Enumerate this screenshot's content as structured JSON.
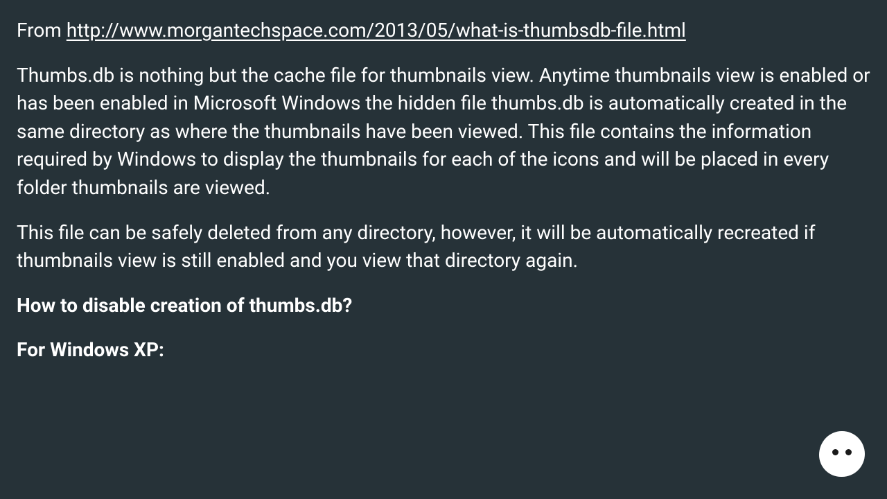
{
  "source": {
    "prefix": "From ",
    "url": "http://www.morgantechspace.com/2013/05/what-is-thumbsdb-file.html"
  },
  "paragraphs": {
    "p1": "Thumbs.db is nothing but the cache file for thumbnails view. Anytime thumbnails view is enabled or has been enabled in Microsoft Windows the hidden file thumbs.db is automatically created in the same directory as where the thumbnails have been viewed. This file contains the information required by Windows to display the thumbnails for each of the icons and will be placed in every folder thumbnails are viewed.",
    "p2": "This file can be safely deleted from any directory, however, it will be automatically recreated if thumbnails view is still enabled and you view that directory again."
  },
  "headings": {
    "h1": "How to disable creation of thumbs.db?",
    "h2": "For Windows XP:"
  }
}
